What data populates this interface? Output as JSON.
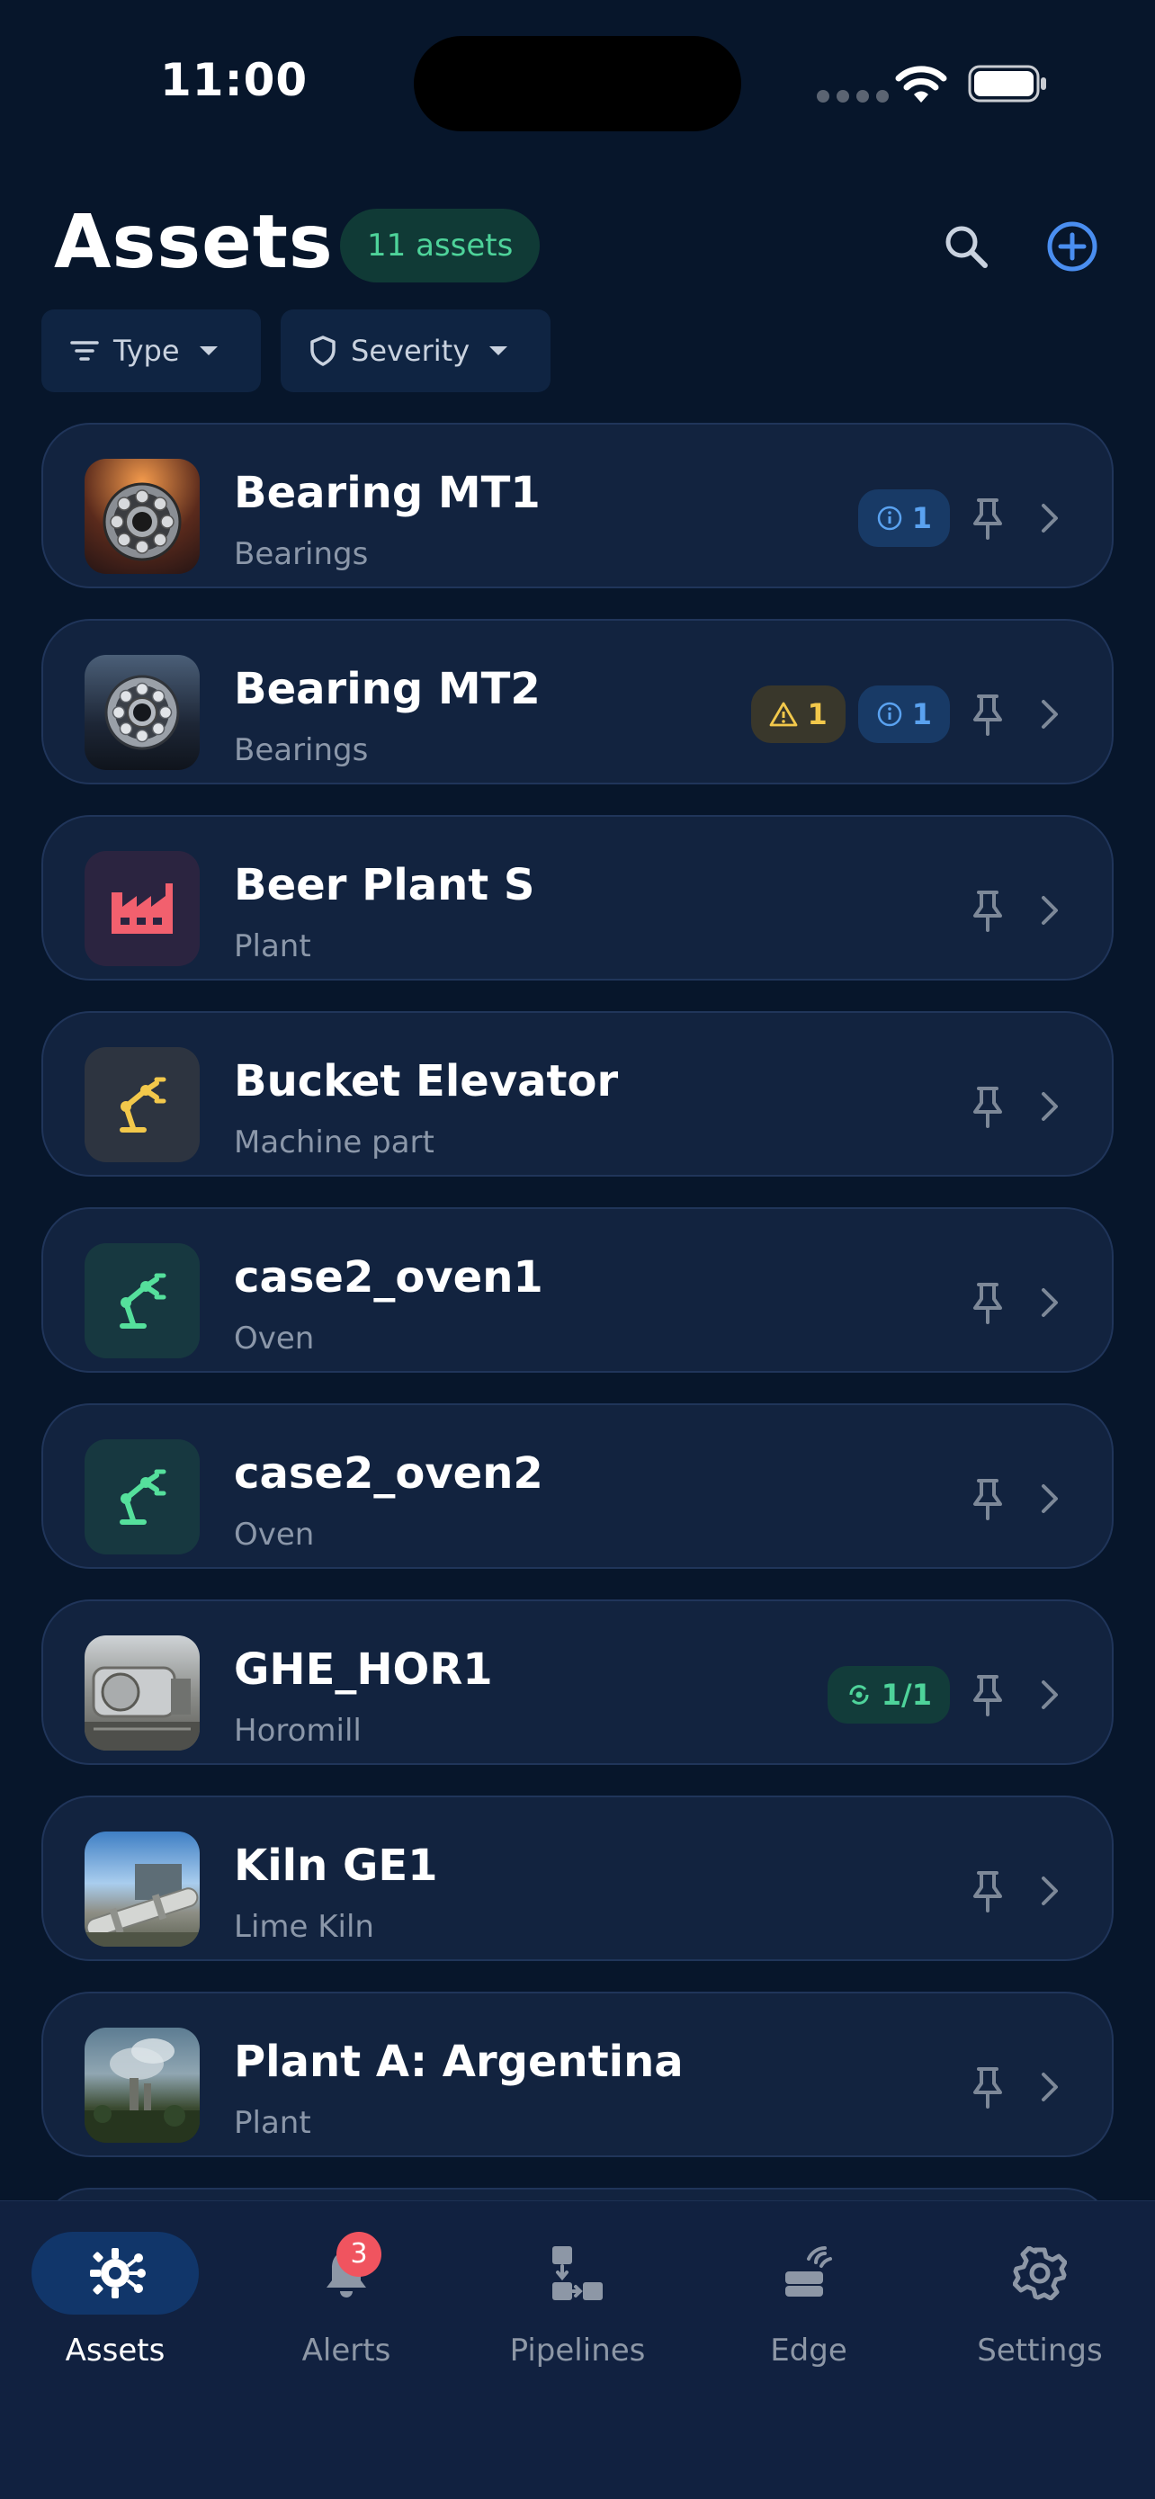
{
  "status_bar": {
    "time": "11:00"
  },
  "header": {
    "title": "Assets",
    "count_label": "11 assets"
  },
  "filters": {
    "type_label": "Type",
    "severity_label": "Severity"
  },
  "assets": [
    {
      "name": "Bearing MT1",
      "type": "Bearings",
      "thumb": "photo-bearing",
      "badges": [
        {
          "kind": "info",
          "icon": "info-icon",
          "value": "1"
        }
      ]
    },
    {
      "name": "Bearing MT2",
      "type": "Bearings",
      "thumb": "photo-bearing",
      "badges": [
        {
          "kind": "warn",
          "icon": "warning-icon",
          "value": "1"
        },
        {
          "kind": "info",
          "icon": "info-icon",
          "value": "1"
        }
      ]
    },
    {
      "name": "Beer Plant S",
      "type": "Plant",
      "thumb": "factory-icon",
      "badges": []
    },
    {
      "name": "Bucket Elevator",
      "type": "Machine part",
      "thumb": "robot-arm-icon",
      "badges": []
    },
    {
      "name": "case2_oven1",
      "type": "Oven",
      "thumb": "robot-arm-icon",
      "badges": []
    },
    {
      "name": "case2_oven2",
      "type": "Oven",
      "thumb": "robot-arm-icon",
      "badges": []
    },
    {
      "name": "GHE_HOR1",
      "type": "Horomill",
      "thumb": "photo-mill",
      "badges": [
        {
          "kind": "ok",
          "icon": "sync-icon",
          "value": "1/1"
        }
      ]
    },
    {
      "name": "Kiln GE1",
      "type": "Lime Kiln",
      "thumb": "photo-kiln",
      "badges": []
    },
    {
      "name": "Plant A: Argentina",
      "type": "Plant",
      "thumb": "photo-plant",
      "badges": []
    }
  ],
  "tabs": [
    {
      "label": "Assets",
      "icon": "assets-icon",
      "active": true
    },
    {
      "label": "Alerts",
      "icon": "bell-icon",
      "badge": "3"
    },
    {
      "label": "Pipelines",
      "icon": "pipelines-icon"
    },
    {
      "label": "Edge",
      "icon": "edge-icon"
    },
    {
      "label": "Settings",
      "icon": "gear-icon"
    }
  ],
  "colors": {
    "background": "#07162b",
    "card": "#12233f",
    "accent_blue": "#4a8ef0",
    "accent_green": "#4ed39a",
    "warn_yellow": "#f2c84b",
    "alert_red": "#f0545f"
  }
}
